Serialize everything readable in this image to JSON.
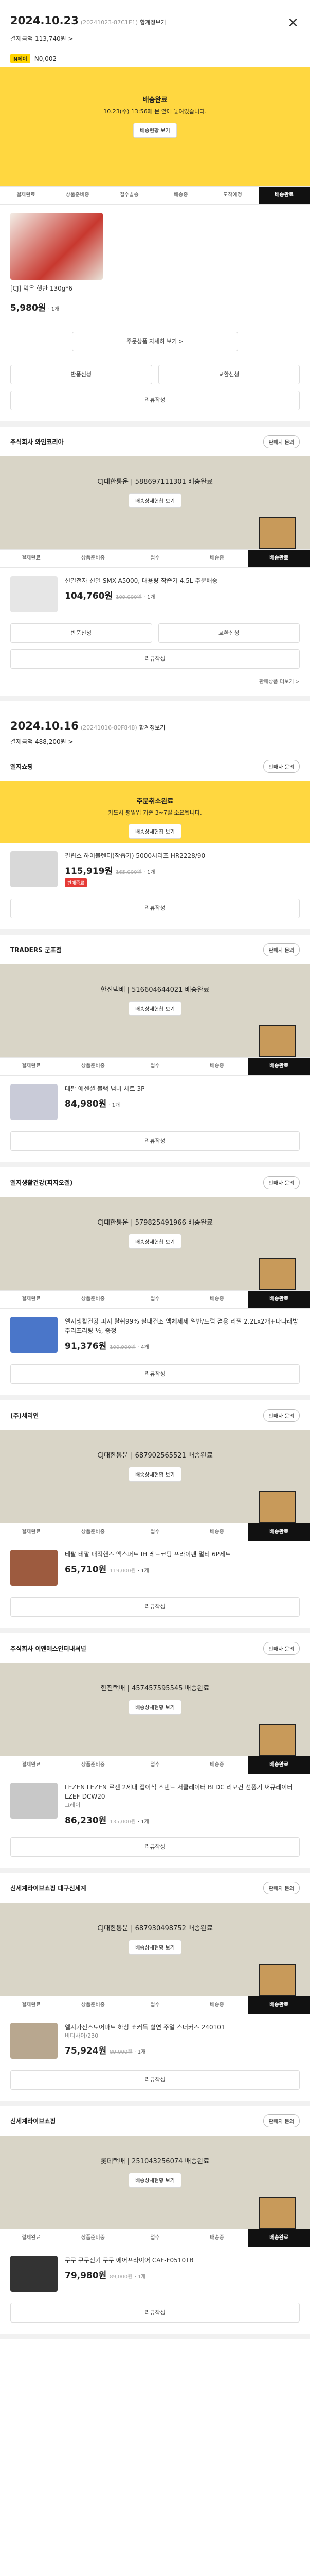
{
  "order1": {
    "date": "2024.10.23",
    "order_no": "(20241023-87C1E1)",
    "detail_link": "합계정보기",
    "payment": "결제금액 113,740원 >",
    "npay": "N페이",
    "npay_amount": "N0,002",
    "status_title": "배송완료",
    "status_msg": "10.23(수) 13:56에 문 앞에 놓여있습니다.",
    "status_btn": "배송현황 보기",
    "track": [
      "결제완료",
      "상품준비중",
      "접수발송",
      "배송중",
      "도착예정",
      "배송완료"
    ],
    "item_name": "[CJ] 먹은 햇반 130g*6",
    "item_price": "5,980원",
    "item_qty": "· 1개",
    "more": "주문상품 자세히 보기 >",
    "btn_return": "반품신청",
    "btn_exchange": "교환신청",
    "btn_review": "리뷰작성"
  },
  "seller2": {
    "name": "주식회사 와임코리아",
    "ask": "판매자 문의",
    "status": "CJ대한통운 | 588697111301 배송완료",
    "btn": "배송상세현황 보기",
    "track": [
      "결제완료",
      "상품준비중",
      "접수",
      "배송중",
      "배송완료"
    ],
    "item_name": "신일전자 신일 SMX-A5000, 대용량 착즙기 4.5L 주문배송",
    "item_price": "104,760원",
    "item_orig": "109,000원",
    "item_qty": "· 1개",
    "btn_return": "반품신청",
    "btn_exchange": "교환신청",
    "btn_review": "리뷰작성",
    "rest": "판매상품 더보기 >"
  },
  "order2": {
    "date": "2024.10.16",
    "order_no": "(20241016-80F848)",
    "detail_link": "합계정보기",
    "payment": "결제금액 488,200원 >"
  },
  "sellers": [
    {
      "name": "엘지쇼핑",
      "ask": "판매자 문의",
      "status": "주문취소완료",
      "sub": "카드사 평일업 기준 3~7일 소요됩니다.",
      "btn": "배송상세현황 보기",
      "item": "필립스 하이볼렌더(착즙기) 5000시리즈 HR2228/90",
      "price": "115,919원",
      "orig": "165,000원",
      "qty": "· 1개",
      "badge": "판매종료",
      "review": "리뷰작성"
    },
    {
      "name": "TRADERS 군포점",
      "ask": "판매자 문의",
      "status": "한진택배 | 516604644021 배송완료",
      "btn": "배송상세현황 보기",
      "item": "테팔 에센셜 블랙 냄비 세트 3P",
      "price": "84,980원",
      "qty": "· 1개",
      "review": "리뷰작성"
    },
    {
      "name": "엘지생활건강(피지오겔)",
      "ask": "판매자 문의",
      "status": "CJ대한통운 | 579825491966 배송완료",
      "btn": "배송상세현황 보기",
      "item": "엘지생활건강 피지 탈취99% 실내건조 액체세제 일반/드럼 겸용 리필 2.2Lx2개+다나래방 주리프리팅 ½, 증정",
      "price": "91,376원",
      "orig": "100,900원",
      "qty": "· 4개",
      "review": "리뷰작성"
    },
    {
      "name": "(주)세리인",
      "ask": "판매자 문의",
      "status": "CJ대한통운 | 687902565521 배송완료",
      "btn": "배송상세현황 보기",
      "item": "테팔 테팔 매직핸즈 엑스퍼트 IH 레드코팅 프라이팬 멀티 6P세트",
      "price": "65,710원",
      "orig": "119,000원",
      "qty": "· 1개",
      "review": "리뷰작성"
    },
    {
      "name": "주식회사 이엔에스인터내셔널",
      "ask": "판매자 문의",
      "status": "한진택배 | 457457595545 배송완료",
      "btn": "배송상세현황 보기",
      "item": "LEZEN LEZEN 르젠 2세대 접이식 스탠드 서큘레이터 BLDC 리모컨 선풍기 써큐레이터 LZEF-DCW20",
      "sub": "그레이",
      "price": "86,230원",
      "orig": "135,000원",
      "qty": "· 1개",
      "review": "리뷰작성"
    },
    {
      "name": "신세계라이브쇼핑 대구신세계",
      "ask": "판매자 문의",
      "status": "CJ대한통운 | 687930498752 배송완료",
      "btn": "배송상세현황 보기",
      "item": "엘지가전스토어마트 하상 쇼커독 혈연 주얼 스너커즈 240101",
      "sub": "비디사이/230",
      "price": "75,924원",
      "orig": "89,000원",
      "qty": "· 1개",
      "review": "리뷰작성"
    },
    {
      "name": "신세계라이브쇼핑",
      "ask": "판매자 문의",
      "status": "롯데택배 | 251043256074 배송완료",
      "btn": "배송상세현황 보기",
      "item": "쿠쿠 쿠쿠전기 쿠쿠 에어프라이어 CAF-F0510TB",
      "price": "79,980원",
      "orig": "89,000원",
      "qty": "· 1개",
      "review": "리뷰작성"
    }
  ],
  "colors": {
    "yellow": "#ffd740",
    "olive": "#d9d5c7",
    "dark": "#111111",
    "red": "#e53935"
  }
}
